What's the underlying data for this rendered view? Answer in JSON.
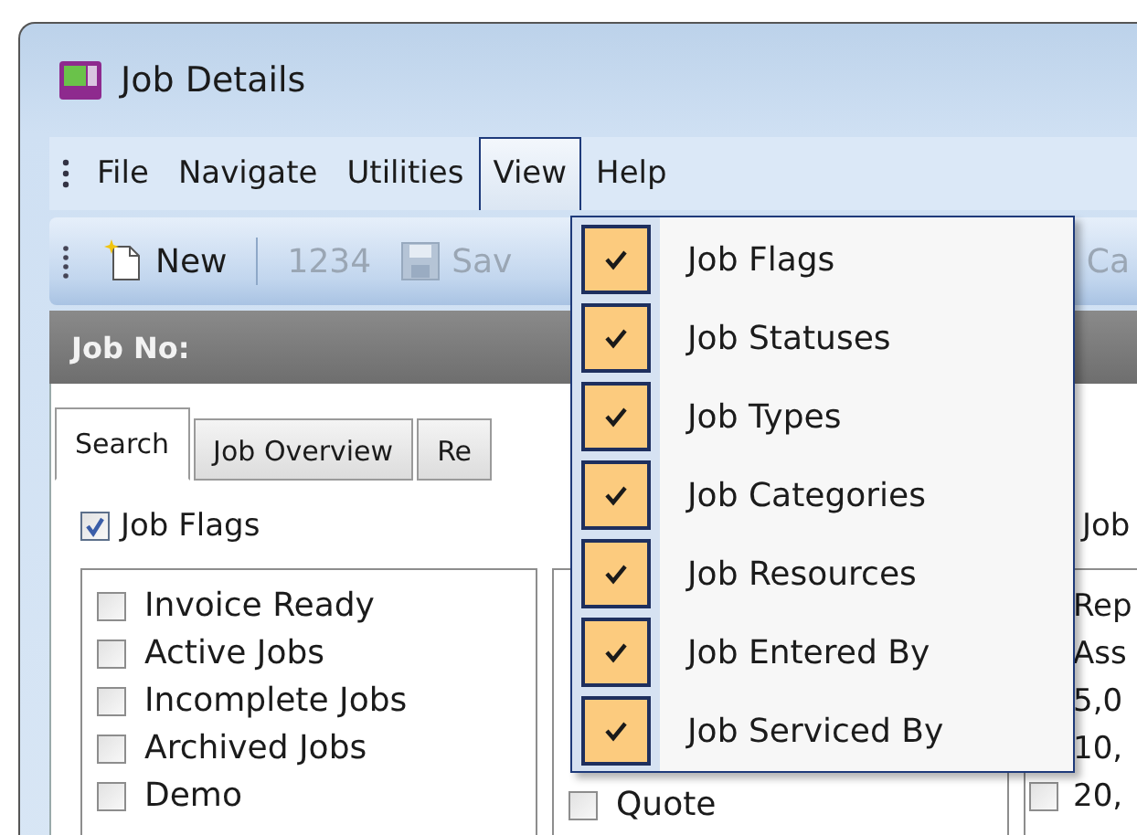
{
  "window": {
    "title": "Job Details"
  },
  "menu_bar": [
    {
      "label": "File",
      "selected": false
    },
    {
      "label": "Navigate",
      "selected": false
    },
    {
      "label": "Utilities",
      "selected": false
    },
    {
      "label": "View",
      "selected": true
    },
    {
      "label": "Help",
      "selected": false
    }
  ],
  "toolbar": [
    {
      "kind": "new",
      "label": "New",
      "disabled": false
    },
    {
      "kind": "separator"
    },
    {
      "kind": "number",
      "label": "1234",
      "disabled": true
    },
    {
      "kind": "save",
      "label": "Sav",
      "disabled": true
    },
    {
      "kind": "text",
      "label": "Ca",
      "disabled": true
    }
  ],
  "job_bar": {
    "label": "Job No:"
  },
  "tabs": [
    {
      "label": "Search",
      "selected": true
    },
    {
      "label": "Job Overview",
      "selected": false
    },
    {
      "label": "Re",
      "selected": false
    }
  ],
  "groups": [
    {
      "heading": "Job Flags",
      "checked": true,
      "items": [
        {
          "kind": "check",
          "label": "Invoice Ready",
          "checked": false
        },
        {
          "kind": "check",
          "label": "Active Jobs",
          "checked": false
        },
        {
          "kind": "check",
          "label": "Incomplete Jobs",
          "checked": false
        },
        {
          "kind": "check",
          "label": "Archived Jobs",
          "checked": false
        },
        {
          "kind": "check",
          "label": "Demo",
          "checked": false
        }
      ]
    },
    {
      "items": [
        {
          "kind": "check",
          "label": "Quote",
          "checked": false
        }
      ]
    },
    {
      "heading": "Job",
      "items": [
        {
          "kind": "text",
          "label": "Rep"
        },
        {
          "kind": "text",
          "label": "Ass"
        },
        {
          "kind": "text",
          "label": "5,0"
        },
        {
          "kind": "text",
          "label": "10,"
        },
        {
          "kind": "check",
          "label": "20,",
          "checked": false
        }
      ]
    }
  ],
  "view_menu": [
    {
      "label": "Job Flags",
      "checked": true
    },
    {
      "label": "Job Statuses",
      "checked": true
    },
    {
      "label": "Job Types",
      "checked": true
    },
    {
      "label": "Job Categories",
      "checked": true
    },
    {
      "label": "Job Resources",
      "checked": true
    },
    {
      "label": "Job Entered By",
      "checked": true
    },
    {
      "label": "Job Serviced By",
      "checked": true
    }
  ]
}
